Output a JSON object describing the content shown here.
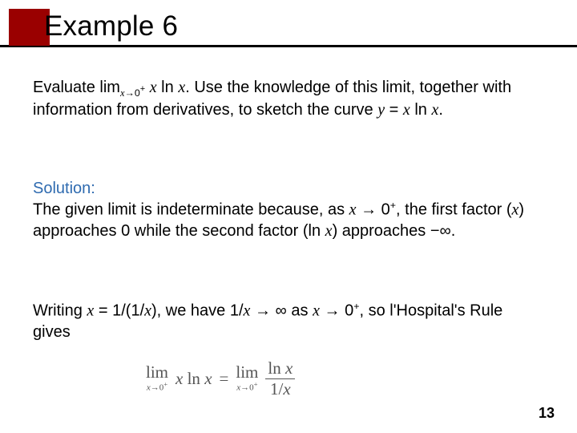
{
  "title": "Example 6",
  "page_number": "13",
  "problem": {
    "pre": "Evaluate lim",
    "sub1": "x",
    "arr": "→",
    "sub2": "0",
    "sup": "+",
    "mid": " ",
    "expr_x": "x",
    "expr_ln": " ln ",
    "expr_x2": "x",
    "after": ". Use the knowledge of this limit, together with information from derivatives, to sketch the curve ",
    "curve_y": "y",
    "curve_eq": " = ",
    "curve_x": "x",
    "curve_ln": " ln ",
    "curve_x2": "x",
    "end": "."
  },
  "solution": {
    "label": "Solution:",
    "s1a": "The given limit is indeterminate because, as ",
    "s1x": "x",
    "s1arr": " → ",
    "s1z": "0",
    "s1sup": "+",
    "s1b": ", the first factor (",
    "s1x2": "x",
    "s1c": ") approaches 0 while the second factor (ln ",
    "s1x3": "x",
    "s1d": ") approaches −∞."
  },
  "writing": {
    "w1a": "Writing ",
    "w1x": "x",
    "w1b": " = 1/(1/",
    "w1x2": "x",
    "w1c": "), we have 1/",
    "w1x3": "x",
    "w1arr": " → ",
    "w1inf": "∞",
    "w1d": "   as ",
    "w1x4": "x",
    "w1arr2": " → ",
    "w1z": "0",
    "w1sup": "+",
    "w1e": ", so l'Hospital's Rule gives"
  },
  "equation": {
    "lim": "lim",
    "limsub_x": "x",
    "limsub_arr": "→",
    "limsub_0p": "0",
    "limsub_plus": "+",
    "lhs_x": "x",
    "lhs_ln": " ln ",
    "lhs_x2": "x",
    "eq": "=",
    "rhs_top_ln": "ln ",
    "rhs_top_x": "x",
    "rhs_bot_1": "1/",
    "rhs_bot_x": "x"
  }
}
